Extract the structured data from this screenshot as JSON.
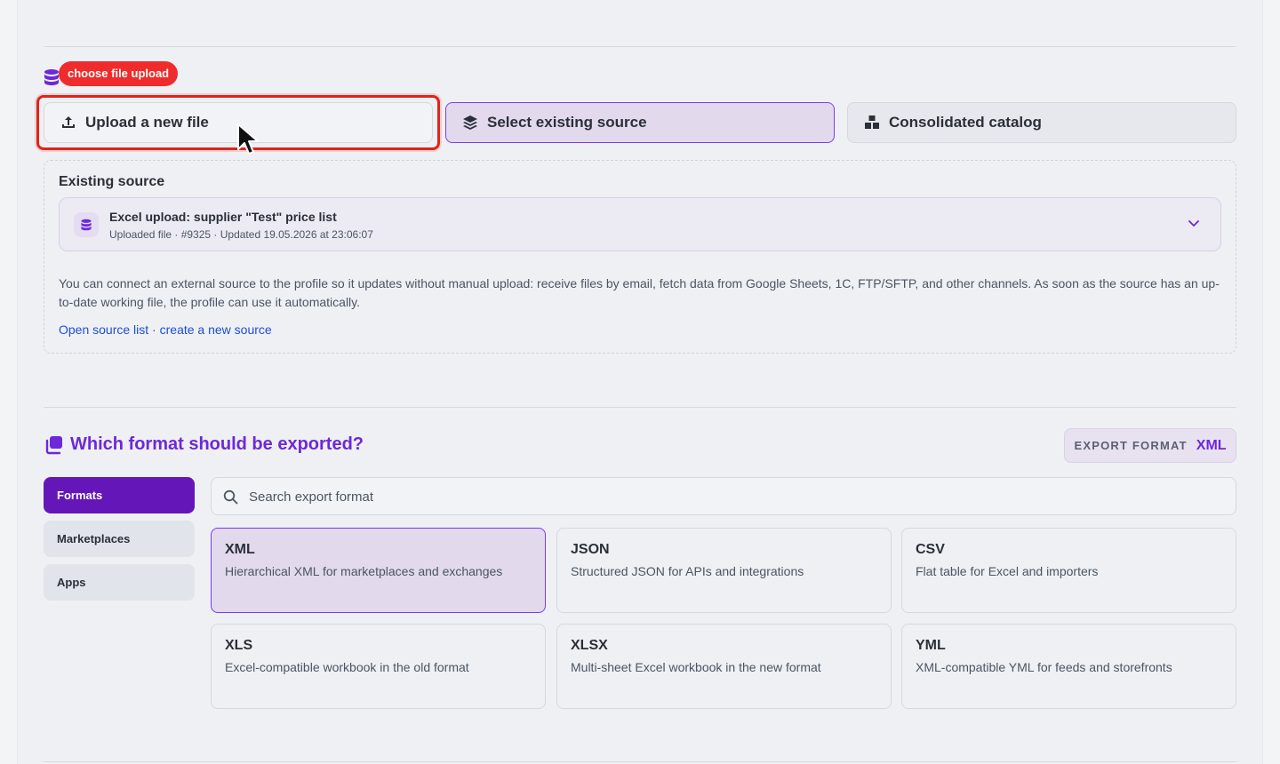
{
  "source_section": {
    "hint_badge": "choose file upload",
    "modes": [
      {
        "label": "Upload a new file",
        "icon": "upload-icon"
      },
      {
        "label": "Select existing source",
        "icon": "layers-icon"
      },
      {
        "label": "Consolidated catalog",
        "icon": "boxes-icon"
      }
    ],
    "existing": {
      "title": "Existing source",
      "selected_title": "Excel upload: supplier \"Test\" price list",
      "selected_subtitle": "Uploaded file · #9325 · Updated 19.05.2026 at 23:06:07",
      "description": "You can connect an external source to the profile so it updates without manual upload: receive files by email, fetch data from Google Sheets, 1C, FTP/SFTP, and other channels. As soon as the source has an up-to-date working file, the profile can use it automatically.",
      "link_open": "Open source list",
      "link_separator": " · ",
      "link_create": "create a new source"
    }
  },
  "format_section": {
    "title": "Which format should be exported?",
    "export_label": "EXPORT FORMAT",
    "export_value": "XML",
    "categories": [
      "Formats",
      "Marketplaces",
      "Apps"
    ],
    "active_category": "Formats",
    "search_placeholder": "Search export format",
    "formats": [
      {
        "name": "XML",
        "desc": "Hierarchical XML for marketplaces and exchanges",
        "selected": true
      },
      {
        "name": "JSON",
        "desc": "Structured JSON for APIs and integrations",
        "selected": false
      },
      {
        "name": "CSV",
        "desc": "Flat table for Excel and importers",
        "selected": false
      },
      {
        "name": "XLS",
        "desc": "Excel-compatible workbook in the old format",
        "selected": false
      },
      {
        "name": "XLSX",
        "desc": "Multi-sheet Excel workbook in the new format",
        "selected": false
      },
      {
        "name": "YML",
        "desc": "XML-compatible YML for feeds and storefronts",
        "selected": false
      }
    ]
  },
  "colors": {
    "accent": "#6d28d9",
    "active_nav": "#6516b8",
    "highlight": "#e2231a"
  }
}
